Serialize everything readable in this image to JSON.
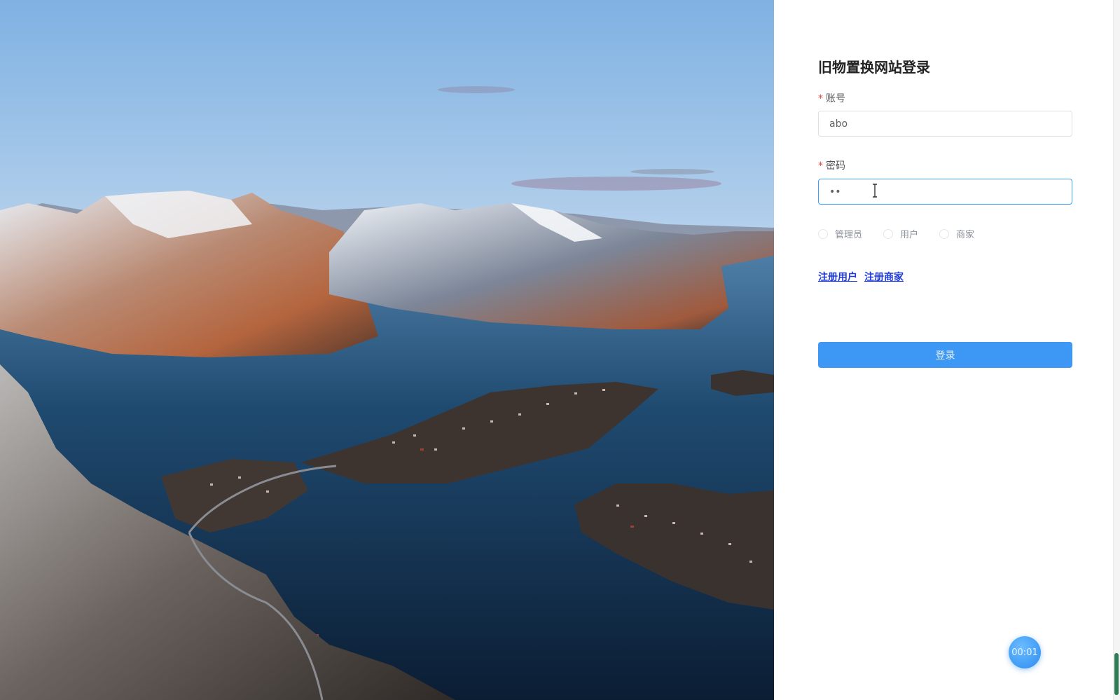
{
  "hero": {
    "image": "mountain-fjord-landscape"
  },
  "login": {
    "title": "旧物置换网站登录",
    "account": {
      "label": "账号",
      "required_mark": "*",
      "value": "abo"
    },
    "password": {
      "label": "密码",
      "required_mark": "*",
      "value": "••"
    },
    "roles": [
      "管理员",
      "用户",
      "商家"
    ],
    "links": {
      "register_user": "注册用户",
      "register_merchant": "注册商家"
    },
    "submit_label": "登录"
  },
  "timer": {
    "label": "00:01"
  },
  "colors": {
    "primary": "#3d97f5",
    "link": "#1f3bd6",
    "required": "#e0443f",
    "focus": "#409eff"
  }
}
